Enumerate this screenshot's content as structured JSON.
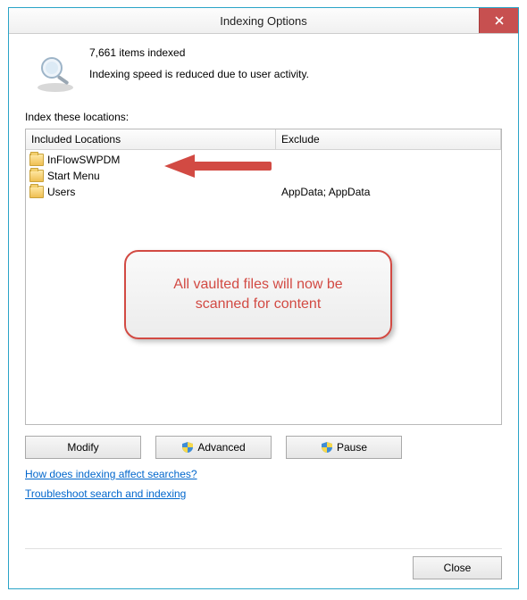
{
  "window": {
    "title": "Indexing Options"
  },
  "status": {
    "items_indexed": "7,661 items indexed",
    "speed_note": "Indexing speed is reduced due to user activity."
  },
  "section_label": "Index these locations:",
  "columns": {
    "included": "Included Locations",
    "exclude": "Exclude"
  },
  "rows": [
    {
      "name": "InFlowSWPDM",
      "exclude": ""
    },
    {
      "name": "Start Menu",
      "exclude": ""
    },
    {
      "name": "Users",
      "exclude": "AppData; AppData"
    }
  ],
  "annotation": {
    "callout": "All vaulted files will now be scanned for content"
  },
  "buttons": {
    "modify": "Modify",
    "advanced": "Advanced",
    "pause": "Pause",
    "close": "Close"
  },
  "links": {
    "how": "How does indexing affect searches?",
    "troubleshoot": "Troubleshoot search and indexing"
  }
}
